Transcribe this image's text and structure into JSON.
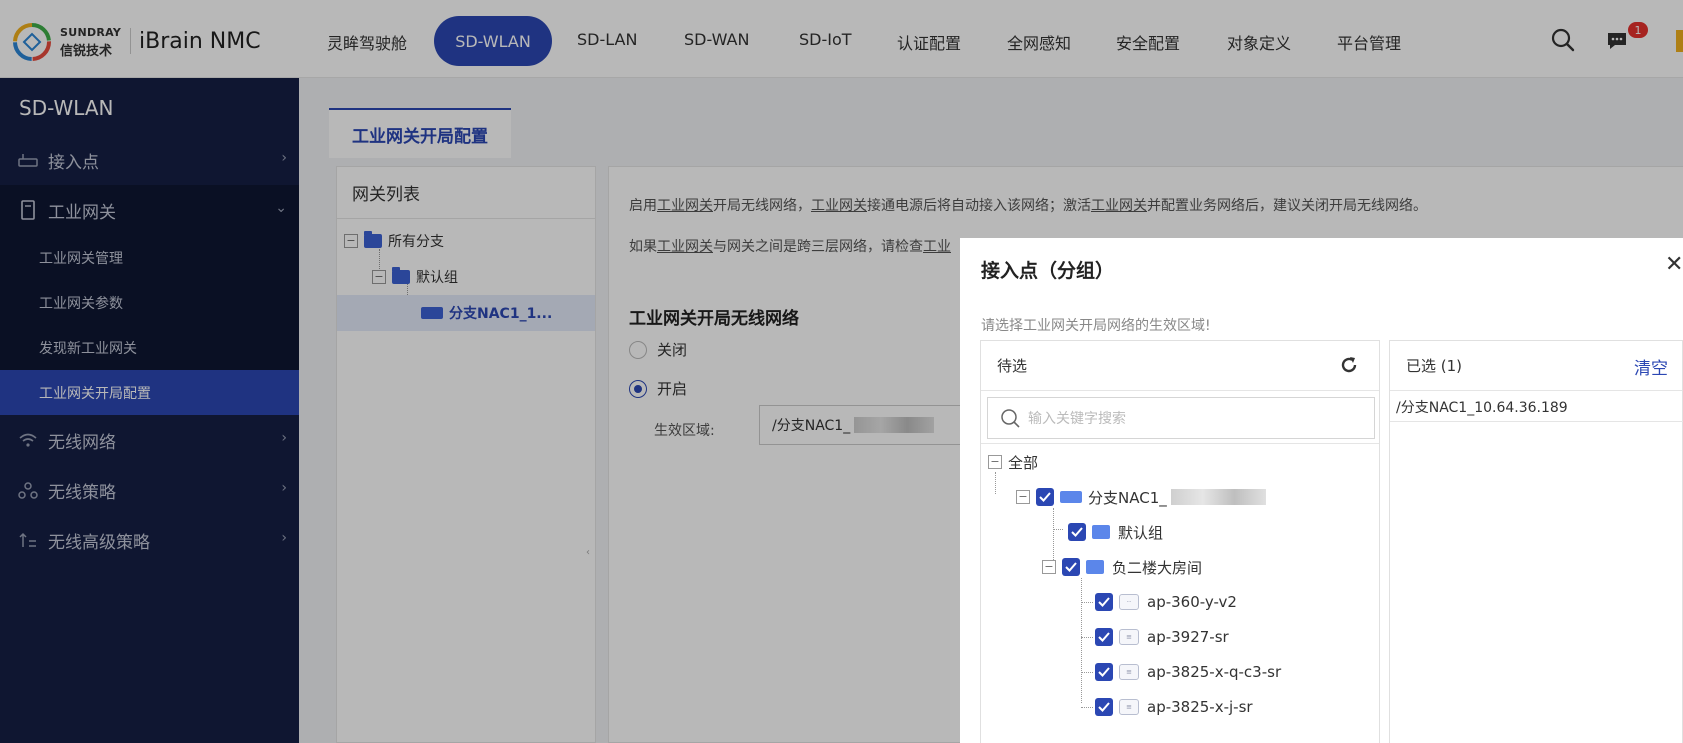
{
  "brand": {
    "name_en": "SUNDRAY",
    "name_cn": "信锐技术",
    "product": "iBrain NMC"
  },
  "nav": {
    "items": [
      "灵眸驾驶舱",
      "SD-WLAN",
      "SD-LAN",
      "SD-WAN",
      "SD-IoT",
      "认证配置",
      "全网感知",
      "安全配置",
      "对象定义",
      "平台管理"
    ],
    "active": "SD-WLAN",
    "message_badge": "1"
  },
  "colors": {
    "accent": "#2b47b3",
    "sidebar_bg": "#151f44",
    "badge": "#e7312d"
  },
  "sidebar": {
    "title": "SD-WLAN",
    "items": [
      {
        "label": "接入点",
        "icon": "router-icon"
      },
      {
        "label": "工业网关",
        "icon": "gateway-icon",
        "expanded": true
      },
      {
        "label": "无线网络",
        "icon": "wifi-icon"
      },
      {
        "label": "无线策略",
        "icon": "policy-icon"
      },
      {
        "label": "无线高级策略",
        "icon": "advanced-policy-icon"
      }
    ],
    "subitems": [
      "工业网关管理",
      "工业网关参数",
      "发现新工业网关",
      "工业网关开局配置"
    ],
    "active_subitem": "工业网关开局配置"
  },
  "main": {
    "tab": "工业网关开局配置",
    "gateway_list": {
      "title": "网关列表",
      "nodes": [
        "所有分支",
        "默认组",
        "分支NAC1_1..."
      ]
    },
    "info_line1_parts": [
      "启用",
      "工业网关",
      "开局无线网络，",
      "工业网关",
      "接通电源后将自动接入该网络；激活",
      "工业网关",
      "并配置业务网络后，建议关闭开局无线网络。"
    ],
    "info_line2_parts": [
      "如果",
      "工业网关",
      "与网关之间是跨三层网络，请检查",
      "工业"
    ],
    "section_title": "工业网关开局无线网络",
    "radio_off": "关闭",
    "radio_on": "开启",
    "area_label": "生效区域:",
    "area_value": "/分支NAC1_"
  },
  "modal": {
    "title": "接入点（分组）",
    "hint": "请选择工业网关开局网络的生效区域!",
    "left": {
      "header": "待选",
      "search_placeholder": "输入关键字搜索",
      "tree": {
        "root": "全部",
        "branch": "分支NAC1_",
        "group_default": "默认组",
        "group_b2": "负二楼大房间",
        "aps": [
          "ap-360-y-v2",
          "ap-3927-sr",
          "ap-3825-x-q-c3-sr",
          "ap-3825-x-j-sr"
        ]
      }
    },
    "right": {
      "header": "已选 (1)",
      "clear": "清空",
      "selected": "/分支NAC1_10.64.36.189"
    }
  }
}
